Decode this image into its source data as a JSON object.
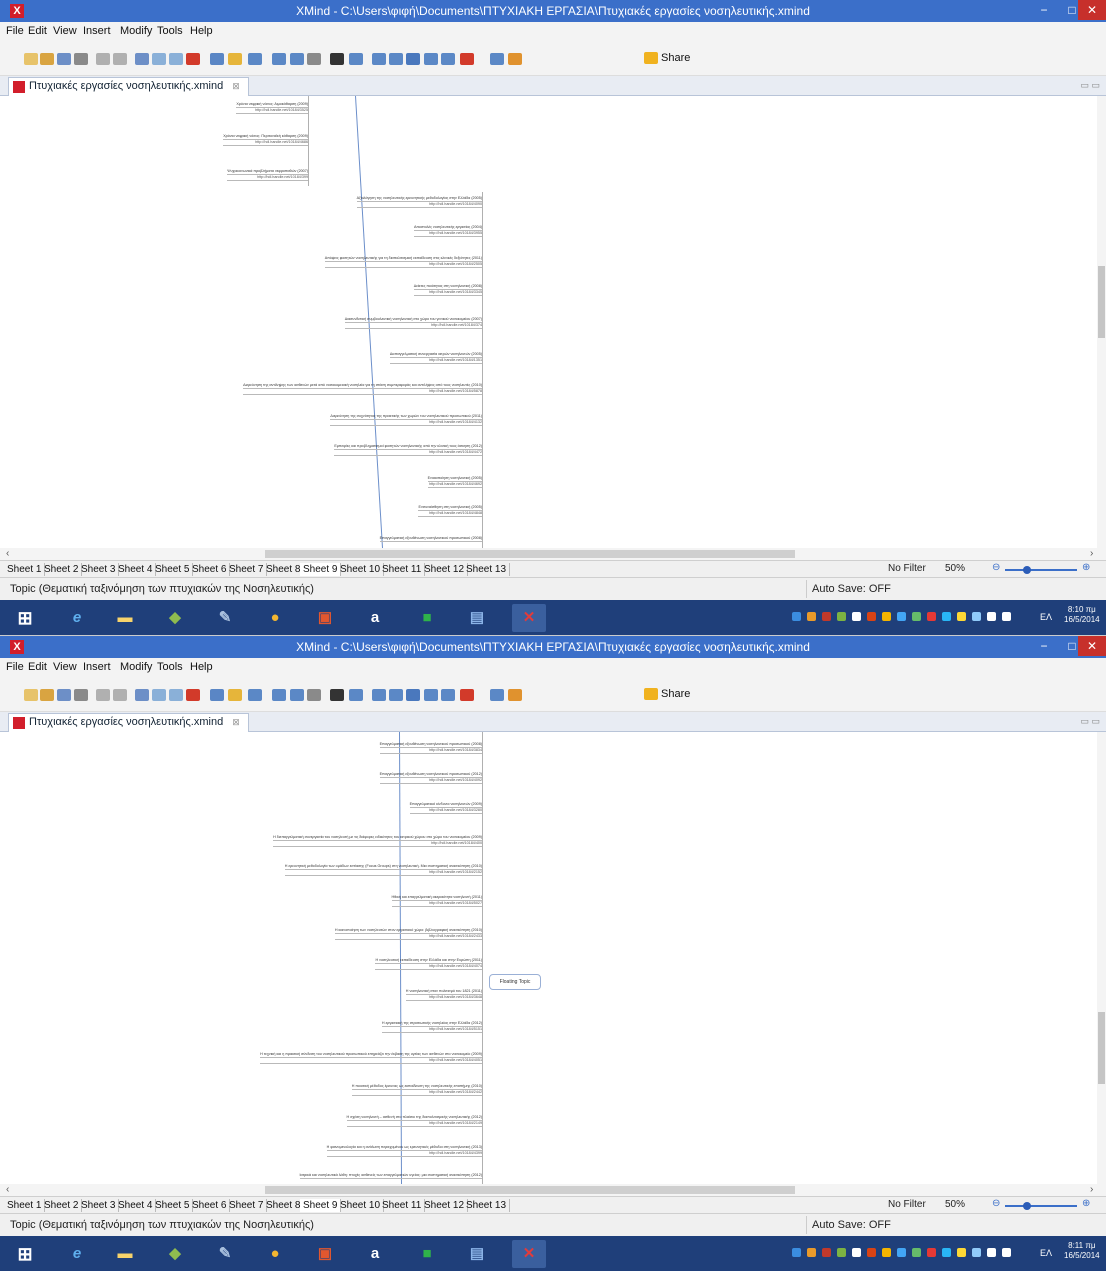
{
  "window": {
    "title": "XMind - C:\\Users\\φιφή\\Documents\\ΠΤΥΧΙΑΚΗ ΕΡΓΑΣΙΑ\\Πτυχιακές εργασίες νοσηλευτικής.xmind",
    "minimize": "−",
    "maximize": "□",
    "close": "✕",
    "app_icon": "X"
  },
  "menu": [
    "File",
    "Edit",
    "View",
    "Insert",
    "Modify",
    "Tools",
    "Help"
  ],
  "toolbar": {
    "share_label": "Share",
    "icons": [
      "new-icon",
      "open-icon",
      "save-icon",
      "print-icon",
      "undo-icon",
      "redo-icon",
      "cut-icon",
      "copy-icon",
      "paste-icon",
      "delete-icon",
      "topic-icon",
      "idea-icon",
      "structure-icon",
      "boundary-icon",
      "summary-icon",
      "relationship-icon",
      "link-icon",
      "image-icon",
      "marker-icon",
      "notes-icon",
      "audio-icon",
      "label-icon",
      "gantt-icon",
      "present-icon",
      "drill-up-icon",
      "drill-down-icon"
    ]
  },
  "editor_tab": {
    "label": "Πτυχιακές εργασίες νοσηλευτικής.xmind",
    "close": "⊠"
  },
  "sheets": [
    "Sheet 1",
    "Sheet 2",
    "Sheet 3",
    "Sheet 4",
    "Sheet 5",
    "Sheet 6",
    "Sheet 7",
    "Sheet 8",
    "Sheet 9",
    "Sheet 10",
    "Sheet 11",
    "Sheet 12",
    "Sheet 13"
  ],
  "active_sheet": "Sheet 9",
  "filter": "No Filter",
  "zoom": "50%",
  "zoom_minus": "⊖",
  "zoom_plus": "⊕",
  "status": {
    "topic": "Topic (Θεματική ταξινόμηση των πτυχιακών της Νοσηλευτικής)",
    "autosave": "Auto Save: OFF"
  },
  "screens": [
    {
      "clock_time": "8:10 πμ",
      "clock_date": "16/5/2014",
      "nodes": [
        {
          "title": "Χρόνια νεφρική νόσος: Αιμοκάθαρση (2009)",
          "url": "http://hdl.handle.net/10184/3525"
        },
        {
          "title": "Χρόνια νεφρική νόσος: Περιτοναϊκή κάθαρση (2009)",
          "url": "http://hdl.handle.net/10184/4686"
        },
        {
          "title": "Ψυχοκοινωνικά προβλήματα νεφροπαθών (2007)",
          "url": "http://hdl.handle.net/10184/399"
        },
        {
          "title": "Αξιολόγηση της νοσηλευτικής ερευνητικής μεθοδολογίας στην Ελλάδα (2005)",
          "url": "http://hdl.handle.net/10184/4090"
        },
        {
          "title": "Αποστολές νοσηλευτικής εργασίας (2004)",
          "url": "http://hdl.handle.net/10184/3955"
        },
        {
          "title": "Απόψεις φοιτητών νοσηλευτικής για τη διαπολιτισμική εκπαίδευση στις κλινικές δεξιότητες (2011)",
          "url": "http://hdl.handle.net/10184/2505"
        },
        {
          "title": "Δείκτες ποιότητας στη νοσηλευτική (2008)",
          "url": "http://hdl.handle.net/10184/3345"
        },
        {
          "title": "Διασυνδετική συμβουλευτική νοσηλευτική στο χώρο του γενικού νοσοκομείου (2007)",
          "url": "http://hdl.handle.net/10184/374"
        },
        {
          "title": "Διεπαγγελματική συνεργασία ιατρών νοσηλευτών (2005)",
          "url": "http://hdl.handle.net/10184/1351"
        },
        {
          "title": "Διερεύνηση της αντίληψης των ασθενών μετά από νοσοκομειακή νοσηλεία για τη στάση συμπεριφοράς και αντιλήψεις από τους νοσηλευτές (2010)",
          "url": "http://hdl.handle.net/10184/5878"
        },
        {
          "title": "Διερεύνηση της συχνότητας της πρακτικής των χωρών του νοσηλευτικού προσωπικού (2011)",
          "url": "http://hdl.handle.net/10184/4132"
        },
        {
          "title": "Εμπειρίες και προβληματισμοί φοιτητών νοσηλευτικής από την κλινική τους άσκηση (2012)",
          "url": "http://hdl.handle.net/10184/4472"
        },
        {
          "title": "Ενιαιοποίηση νοσηλευτική (2005)",
          "url": "http://hdl.handle.net/10184/4692"
        },
        {
          "title": "Ενσυναίσθηση στη νοσηλευτική (2005)",
          "url": "http://hdl.handle.net/10184/4848"
        },
        {
          "title": "Επαγγελματική εξουθένωση νοσηλευτικού προσωπικού (2008)",
          "url": ""
        }
      ]
    },
    {
      "clock_time": "8:11 πμ",
      "clock_date": "16/5/2014",
      "floating_topic": "Floating Topic",
      "nodes": [
        {
          "title": "Επαγγελματική εξουθένωση νοσηλευτικού προσωπικού (2008)",
          "url": "http://hdl.handle.net/10184/3834"
        },
        {
          "title": "Επαγγελματική εξουθένωση νοσηλευτικού προσωπικού (2012)",
          "url": "http://hdl.handle.net/10184/4092"
        },
        {
          "title": "Επαγγελματικοί κίνδυνοι νοσηλευτών (2009)",
          "url": "http://hdl.handle.net/10184/3280"
        },
        {
          "title": "Η διεπαγγελματική συνεργασία του νοσηλευτή με τις διάφορες ειδικότητες του ιατρικού χώρου στο χώρο του νοσοκομείου (2009)",
          "url": "http://hdl.handle.net/10184/400"
        },
        {
          "title": "Η ερευνητική μεθοδολογία των ομάδων εστίασης (Focus Groups) στη νοσηλευτική. Μια συστηματική ανασκόπηση (2010)",
          "url": "http://hdl.handle.net/10184/2152"
        },
        {
          "title": "Ηθική και επαγγελματική ακεραιότητα νοσηλευτή (2011)",
          "url": "http://hdl.handle.net/10184/5027"
        },
        {
          "title": "Η ικανοποίηση των νοσηλευτών στον εργασιακό χώρο: βιβλιογραφική ανασκόπηση (2010)",
          "url": "http://hdl.handle.net/10184/2433"
        },
        {
          "title": "Η νοσηλευτική εκπαίδευση στην Ελλάδα και στην Ευρώπη (2011)",
          "url": "http://hdl.handle.net/10184/4074"
        },
        {
          "title": "Η νοσηλευτική στον πολιτισμό του 1821 (2011)",
          "url": "http://hdl.handle.net/10184/3648"
        },
        {
          "title": "Η εργασιακή της στρατιωτικής νοσηλείας στην Ελλάδα (2012)",
          "url": "http://hdl.handle.net/10184/5151"
        },
        {
          "title": "Η τεχνική και η πρακτική σύνδεση του νοσηλευτικού προσωπικού επηρεάζει την έκβαση της υγείας των ασθενών στο νοσοκομείο (2009)",
          "url": "http://hdl.handle.net/10184/4051"
        },
        {
          "title": "Η ποιοτική μέθοδος έρευνας ως εκπαίδευση της νοσηλευτικής επιστήμης (2010)",
          "url": "http://hdl.handle.net/10184/2442"
        },
        {
          "title": "Η σχέση νοσηλευτή – ασθενή στο πλαίσιο της διαπολιτισμικής νοσηλευτικής (2012)",
          "url": "http://hdl.handle.net/10184/2149"
        },
        {
          "title": "Η φαινομενολογία και η ανάλυση περιεχομένου ως ερευνητικές μέθοδοι στη νοσηλευτική (2013)",
          "url": "http://hdl.handle.net/10184/4399"
        },
        {
          "title": "Ιατρικά και νοσηλευτικά λάθη: πτυχές ασθενείς των επαγγελματιών υγείας: μια συστηματική ανασκόπηση (2012)",
          "url": ""
        }
      ]
    }
  ]
}
